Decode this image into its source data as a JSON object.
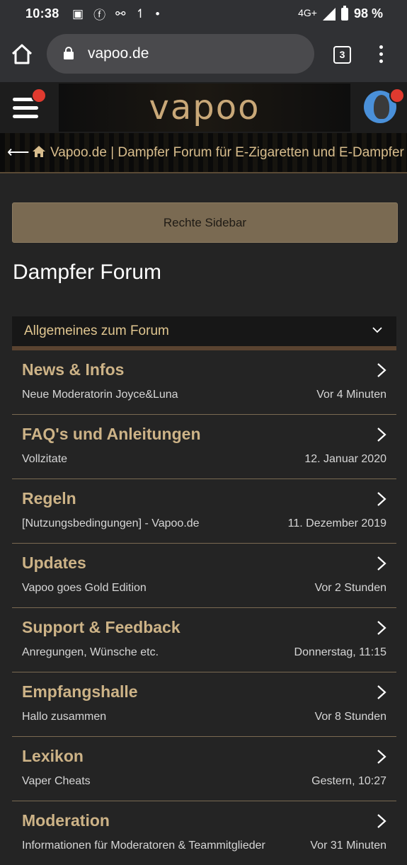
{
  "status_bar": {
    "time": "10:38",
    "network": "4G+",
    "battery": "98 %",
    "icons": [
      "image-icon",
      "facebook-icon",
      "share-icon",
      "wifi-call-icon",
      "dot-icon",
      "signal-icon",
      "battery-icon"
    ]
  },
  "browser": {
    "url": "vapoo.de",
    "tab_count": "3"
  },
  "site_header": {
    "logo_text": "vapoo"
  },
  "breadcrumb": {
    "text": "Vapoo.de | Dampfer Forum für E-Zigaretten und E-Dampfer"
  },
  "sidebar_button": "Rechte Sidebar",
  "page_title": "Dampfer Forum",
  "category": {
    "title": "Allgemeines zum Forum"
  },
  "forums": [
    {
      "title": "News & Infos",
      "last_post": "Neue Moderatorin Joyce&Luna",
      "time": "Vor 4 Minuten"
    },
    {
      "title": "FAQ's und Anleitungen",
      "last_post": "Vollzitate",
      "time": "12. Januar 2020"
    },
    {
      "title": "Regeln",
      "last_post": "[Nutzungsbedingungen] - Vapoo.de",
      "time": "11. Dezember 2019"
    },
    {
      "title": "Updates",
      "last_post": "Vapoo goes Gold Edition",
      "time": "Vor 2 Stunden"
    },
    {
      "title": "Support & Feedback",
      "last_post": "Anregungen, Wünsche etc.",
      "time": "Donnerstag, 11:15"
    },
    {
      "title": "Empfangshalle",
      "last_post": "Hallo zusammen",
      "time": "Vor 8 Stunden"
    },
    {
      "title": "Lexikon",
      "last_post": "Vaper Cheats",
      "time": "Gestern, 10:27"
    },
    {
      "title": "Moderation",
      "last_post": "Informationen für Moderatoren & Teammitglieder",
      "time": "Vor 31 Minuten"
    }
  ],
  "colors": {
    "accent": "#cdb387",
    "background": "#242424",
    "sidebar_button": "#7a6a52",
    "notification": "#e03a2f"
  }
}
